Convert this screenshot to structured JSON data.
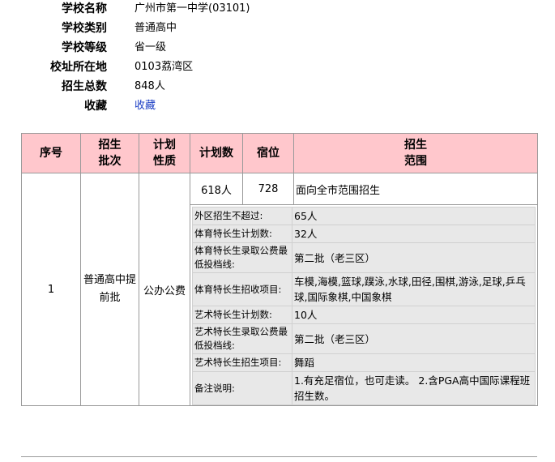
{
  "school_info": {
    "name_label": "学校名称",
    "name_value": "广州市第一中学(03101)",
    "type_label": "学校类别",
    "type_value": "普通高中",
    "level_label": "学校等级",
    "level_value": "省一级",
    "address_label": "校址所在地",
    "address_value": "0103荔湾区",
    "total_label": "招生总数",
    "total_value": "848人",
    "favorite_label": "收藏",
    "favorite_link": "收藏"
  },
  "table": {
    "headers": {
      "seq": "序号",
      "batch_1": "招生",
      "batch_2": "批次",
      "nature_1": "计划",
      "nature_2": "性质",
      "plan_count": "计划数",
      "dorm": "宿位",
      "range_1": "招生",
      "range_2": "范围"
    },
    "row": {
      "seq": "1",
      "batch": "普通高中提前批",
      "nature": "公办公费",
      "plan_count": "618人",
      "dorm": "728",
      "range": "面向全市范围招生"
    },
    "details": [
      {
        "label": "外区招生不超过:",
        "value": "65人"
      },
      {
        "label": "体育特长生计划数:",
        "value": "32人"
      },
      {
        "label": "体育特长生录取公费最低投档线:",
        "value": "第二批（老三区）"
      },
      {
        "label": "体育特长生招收项目:",
        "value": "车模,海模,篮球,蹼泳,水球,田径,围棋,游泳,足球,乒乓球,国际象棋,中国象棋"
      },
      {
        "label": "艺术特长生计划数:",
        "value": "10人"
      },
      {
        "label": "艺术特长生录取公费最低投档线:",
        "value": "第二批（老三区）"
      },
      {
        "label": "艺术特长生招生项目:",
        "value": "舞蹈"
      },
      {
        "label": "备注说明:",
        "value": "1.有充足宿位，也可走读。 2.含PGA高中国际课程班招生数。"
      }
    ]
  }
}
